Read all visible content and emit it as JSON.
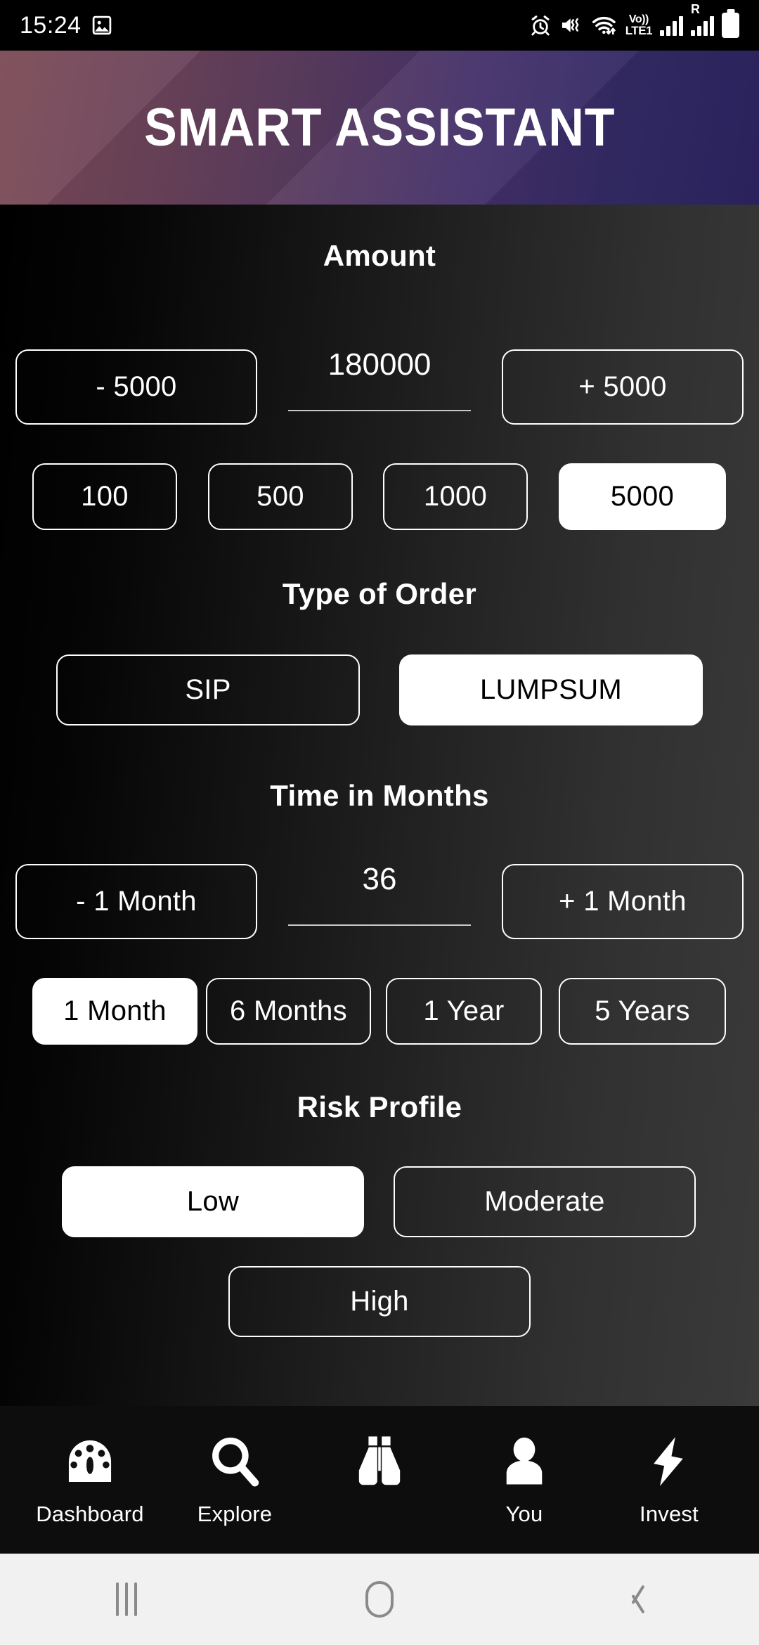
{
  "status_bar": {
    "time": "15:24",
    "icons": [
      "image-icon",
      "alarm-icon",
      "vibrate-mute-icon",
      "wifi-icon",
      "volte-icon",
      "signal-bars-icon",
      "roaming-signal-icon",
      "battery-icon"
    ],
    "volte_top": "Vo))",
    "volte_bottom": "LTE1",
    "roaming_label": "R"
  },
  "header": {
    "title": "SMART ASSISTANT"
  },
  "amount": {
    "label": "Amount",
    "decrement_label": "- 5000",
    "value": "180000",
    "increment_label": "+ 5000",
    "presets": [
      {
        "label": "100",
        "selected": false
      },
      {
        "label": "500",
        "selected": false
      },
      {
        "label": "1000",
        "selected": false
      },
      {
        "label": "5000",
        "selected": true
      }
    ]
  },
  "order_type": {
    "label": "Type of Order",
    "options": [
      {
        "label": "SIP",
        "selected": false
      },
      {
        "label": "LUMPSUM",
        "selected": true
      }
    ]
  },
  "duration": {
    "label": "Time in Months",
    "decrement_label": "- 1 Month",
    "value": "36",
    "increment_label": "+ 1 Month",
    "presets": [
      {
        "label": "1 Month",
        "selected": true
      },
      {
        "label": "6 Months",
        "selected": false
      },
      {
        "label": "1 Year",
        "selected": false
      },
      {
        "label": "5 Years",
        "selected": false
      }
    ]
  },
  "risk_profile": {
    "label": "Risk Profile",
    "options": [
      {
        "label": "Low",
        "selected": true
      },
      {
        "label": "Moderate",
        "selected": false
      },
      {
        "label": "High",
        "selected": false
      }
    ]
  },
  "bottom_nav": {
    "items": [
      {
        "label": "Dashboard",
        "icon": "speedometer-icon"
      },
      {
        "label": "Explore",
        "icon": "search-icon"
      },
      {
        "label": "",
        "icon": "binoculars-icon"
      },
      {
        "label": "You",
        "icon": "person-icon"
      },
      {
        "label": "Invest",
        "icon": "lightning-bolt-icon"
      }
    ]
  },
  "system_nav": {
    "recents": "recents-icon",
    "home": "home-icon",
    "back": "back-icon"
  },
  "colors": {
    "accent_selected_bg": "#ffffff",
    "accent_selected_text": "#000000",
    "outline": "#ffffff",
    "header_gradient_start": "#7b4a55",
    "header_gradient_end": "#2d2462"
  }
}
